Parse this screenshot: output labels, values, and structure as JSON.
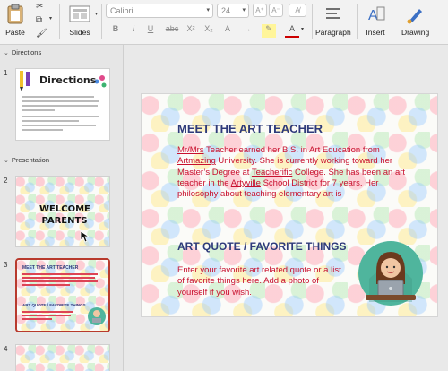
{
  "ribbon": {
    "paste_label": "Paste",
    "slides_label": "Slides",
    "font_name": "Calibri",
    "font_size": "24",
    "paragraph_label": "Paragraph",
    "insert_label": "Insert",
    "drawing_label": "Drawing"
  },
  "sections": [
    {
      "label": "Directions"
    },
    {
      "label": "Presentation"
    }
  ],
  "thumbs": [
    {
      "number": "1",
      "title": "Directions"
    },
    {
      "number": "2",
      "title": "WELCOME PARENTS"
    },
    {
      "number": "3",
      "title": "MEET THE ART TEACHER",
      "subtitle": "ART QUOTE / FAVORITE THINGS"
    },
    {
      "number": "4"
    }
  ],
  "slide": {
    "title1": "MEET THE ART TEACHER",
    "body1_parts": [
      "Mr/Mrs",
      " Teacher earned her B.S. in Art Education from ",
      "Artmazing",
      " University. She is currently working toward her Master’s Degree at ",
      "Teacherific",
      " College. She has been an art teacher in the ",
      "Artyville",
      " School District for 7 years. Her philosophy about teaching elementary art is"
    ],
    "title2": "ART QUOTE / FAVORITE THINGS",
    "body2": "Enter your favorite art related quote or a list of favorite things here. Add a photo of yourself if you wish."
  },
  "colors": {
    "title": "#2e3a7a",
    "body": "#c8102e",
    "selection": "#b83a2d"
  }
}
